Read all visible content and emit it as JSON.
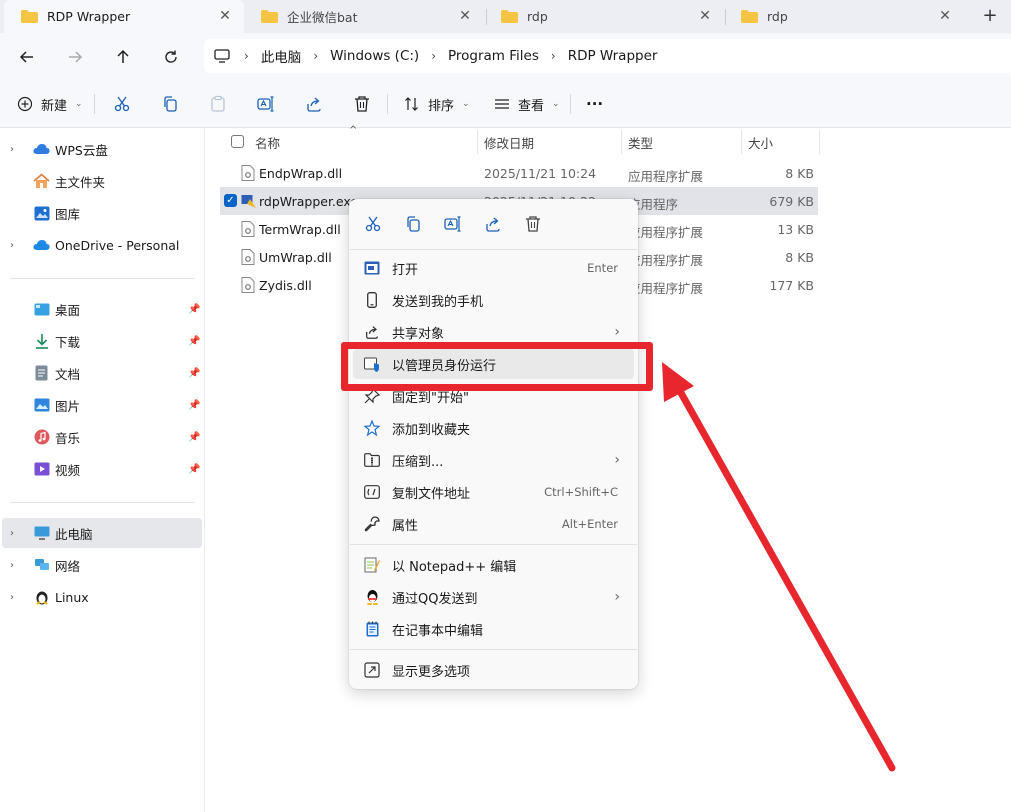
{
  "tabs": [
    {
      "label": "RDP Wrapper",
      "active": true
    },
    {
      "label": "企业微信bat",
      "active": false
    },
    {
      "label": "rdp",
      "active": false
    },
    {
      "label": "rdp",
      "active": false
    }
  ],
  "new_tab_glyph": "+",
  "breadcrumb": [
    "此电脑",
    "Windows (C:)",
    "Program Files",
    "RDP Wrapper"
  ],
  "toolbar": {
    "new_label": "新建",
    "sort_label": "排序",
    "view_label": "查看",
    "more_glyph": "···"
  },
  "sidebar": {
    "top_items": [
      {
        "label": "WPS云盘",
        "expandable": true,
        "icon": "cloud-icon"
      },
      {
        "label": "主文件夹",
        "expandable": false,
        "icon": "home-icon"
      },
      {
        "label": "图库",
        "expandable": false,
        "icon": "gallery-icon"
      },
      {
        "label": "OneDrive - Personal",
        "expandable": true,
        "icon": "onedrive-icon"
      }
    ],
    "quick_access": [
      {
        "label": "桌面",
        "icon": "desktop-icon"
      },
      {
        "label": "下载",
        "icon": "download-icon"
      },
      {
        "label": "文档",
        "icon": "document-icon"
      },
      {
        "label": "图片",
        "icon": "pictures-icon"
      },
      {
        "label": "音乐",
        "icon": "music-icon"
      },
      {
        "label": "视频",
        "icon": "video-icon"
      }
    ],
    "bottom_items": [
      {
        "label": "此电脑",
        "icon": "computer-icon",
        "selected": true
      },
      {
        "label": "网络",
        "icon": "network-icon",
        "selected": false
      },
      {
        "label": "Linux",
        "icon": "linux-icon",
        "selected": false
      }
    ]
  },
  "columns": {
    "name": "名称",
    "date": "修改日期",
    "type": "类型",
    "size": "大小"
  },
  "files": [
    {
      "name": "EndpWrap.dll",
      "date": "2025/11/21 10:24",
      "type": "应用程序扩展",
      "size": "8 KB",
      "selected": false
    },
    {
      "name": "rdpWrapper.exe",
      "date": "2025/11/21 10:22",
      "type": "应用程序",
      "size": "679 KB",
      "selected": true
    },
    {
      "name": "TermWrap.dll",
      "date": "",
      "type": "应用程序扩展",
      "size": "13 KB",
      "selected": false
    },
    {
      "name": "UmWrap.dll",
      "date": "",
      "type": "应用程序扩展",
      "size": "8 KB",
      "selected": false
    },
    {
      "name": "Zydis.dll",
      "date": "",
      "type": "应用程序扩展",
      "size": "177 KB",
      "selected": false
    }
  ],
  "context_menu": {
    "quick_actions": [
      "cut-icon",
      "copy-icon",
      "rename-icon",
      "share-icon",
      "delete-icon"
    ],
    "items": [
      {
        "label": "打开",
        "shortcut": "Enter",
        "icon": "open-icon",
        "submenu": false
      },
      {
        "label": "发送到我的手机",
        "shortcut": "",
        "icon": "phone-icon",
        "submenu": false
      },
      {
        "label": "共享对象",
        "shortcut": "",
        "icon": "share-icon",
        "submenu": true
      },
      {
        "label": "以管理员身份运行",
        "shortcut": "",
        "icon": "admin-shield-icon",
        "submenu": false,
        "highlighted": true
      },
      {
        "label": "固定到\"开始\"",
        "shortcut": "",
        "icon": "pin-icon",
        "submenu": false
      },
      {
        "label": "添加到收藏夹",
        "shortcut": "",
        "icon": "star-icon",
        "submenu": false
      },
      {
        "label": "压缩到...",
        "shortcut": "",
        "icon": "zip-icon",
        "submenu": true
      },
      {
        "label": "复制文件地址",
        "shortcut": "Ctrl+Shift+C",
        "icon": "copy-path-icon",
        "submenu": false
      },
      {
        "label": "属性",
        "shortcut": "Alt+Enter",
        "icon": "wrench-icon",
        "submenu": false
      }
    ],
    "items2": [
      {
        "label": "以 Notepad++ 编辑",
        "icon": "notepadpp-icon",
        "submenu": false
      },
      {
        "label": "通过QQ发送到",
        "icon": "qq-icon",
        "submenu": true
      },
      {
        "label": "在记事本中编辑",
        "icon": "notepad-icon",
        "submenu": false
      }
    ],
    "more_label": "显示更多选项"
  },
  "colors": {
    "annotation_red": "#e8262e",
    "selection_blue": "#0a64c8",
    "folder_yellow": "#f4c542"
  }
}
